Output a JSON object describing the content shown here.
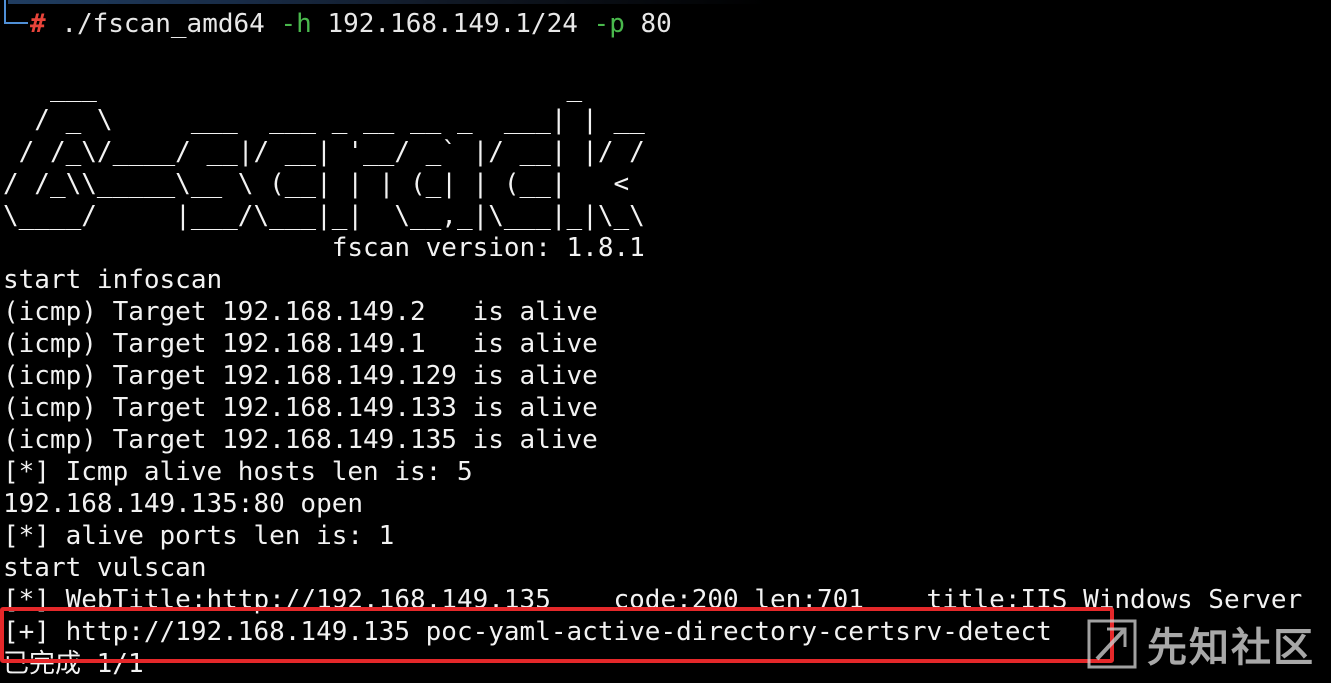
{
  "prompt": {
    "hash": "#",
    "command": "./fscan_amd64",
    "flag_h": "-h",
    "target": "192.168.149.1/24",
    "flag_p": "-p",
    "port": "80"
  },
  "banner": [
    "   ___                              _",
    "  / _ \\     ___  ___ _ __ __ _  ___| | __",
    " / /_\\/____/ __|/ __| '__/ _` |/ __| |/ /",
    "/ /_\\\\_____\\__ \\ (__| | | (_| | (__|   <",
    "\\____/     |___/\\___|_|  \\__,_|\\___|_|\\_\\",
    "                     fscan version: 1.8.1"
  ],
  "output": [
    "start infoscan",
    "(icmp) Target 192.168.149.2   is alive",
    "(icmp) Target 192.168.149.1   is alive",
    "(icmp) Target 192.168.149.129 is alive",
    "(icmp) Target 192.168.149.133 is alive",
    "(icmp) Target 192.168.149.135 is alive",
    "[*] Icmp alive hosts len is: 5",
    "192.168.149.135:80 open",
    "[*] alive ports len is: 1",
    "start vulscan",
    "[*] WebTitle:http://192.168.149.135    code:200 len:701    title:IIS Windows Server",
    "[+] http://192.168.149.135 poc-yaml-active-directory-certsrv-detect",
    "已完成 1/1"
  ],
  "watermark": {
    "text": "先知社区",
    "icon": "xianzhi-logo-icon"
  },
  "colors": {
    "background": "#000000",
    "text": "#f2f2f2",
    "prompt_hash": "#e8443a",
    "flag": "#49b84c",
    "highlight_border": "#e5282a"
  }
}
